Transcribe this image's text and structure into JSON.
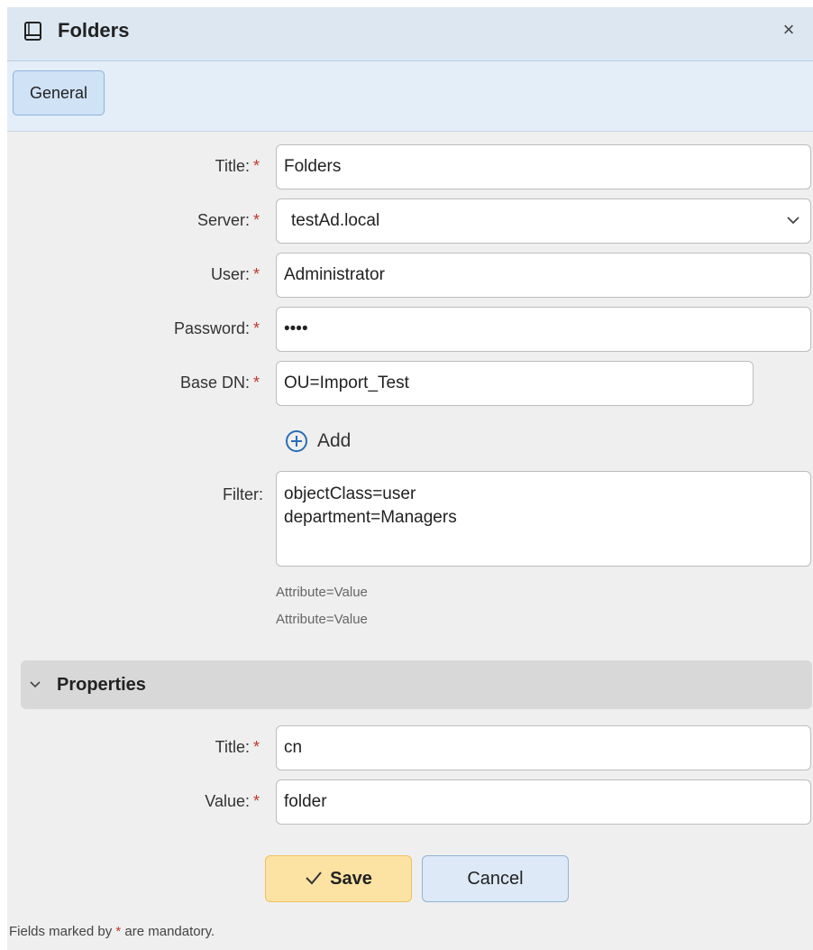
{
  "dialog": {
    "title": "Folders",
    "close_icon": "×"
  },
  "tabs": [
    {
      "label": "General",
      "active": true
    }
  ],
  "form": {
    "title": {
      "label": "Title:",
      "required_mark": "*",
      "value": "Folders"
    },
    "server": {
      "label": "Server:",
      "required_mark": "*",
      "value": "testAd.local"
    },
    "user": {
      "label": "User:",
      "required_mark": "*",
      "value": "Administrator"
    },
    "password": {
      "label": "Password:",
      "required_mark": "*",
      "value": "••••"
    },
    "base_dn": {
      "label": "Base DN:",
      "required_mark": "*",
      "value": "OU=Import_Test"
    },
    "add_label": "Add",
    "filter": {
      "label": "Filter:",
      "lines": [
        "objectClass=user",
        "department=Managers"
      ],
      "hints": [
        "Attribute=Value",
        "Attribute=Value"
      ]
    }
  },
  "properties": {
    "section_title": "Properties",
    "title": {
      "label": "Title:",
      "required_mark": "*",
      "value": "cn"
    },
    "value": {
      "label": "Value:",
      "required_mark": "*",
      "value": "folder"
    }
  },
  "buttons": {
    "save_label": "Save",
    "cancel_label": "Cancel"
  },
  "footer": {
    "note_prefix": "Fields marked by",
    "note_mark": "*",
    "note_suffix": "are mandatory."
  },
  "colors": {
    "titlebar_bg": "#dde7f1",
    "tab_active_bg": "#cfe2f6",
    "save_bg": "#fce3a3",
    "cancel_bg": "#dde9f7",
    "required": "#c0392b",
    "accent": "#2a6db5"
  }
}
